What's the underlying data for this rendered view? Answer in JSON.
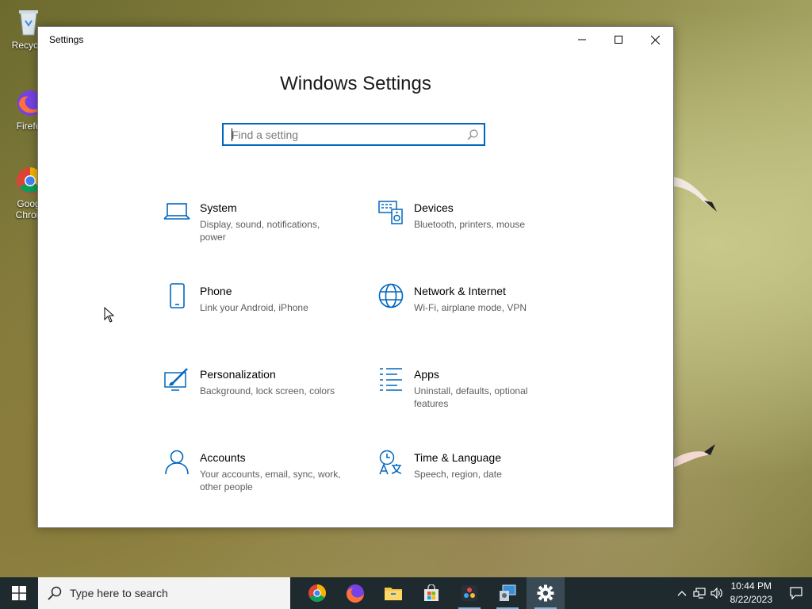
{
  "desktop": {
    "icons": [
      {
        "label": "Recycle"
      },
      {
        "label": "Firefo"
      },
      {
        "label": "Goog",
        "label2": "Chron"
      }
    ]
  },
  "window": {
    "title": "Settings",
    "heading": "Windows Settings",
    "search_placeholder": "Find a setting",
    "tiles": [
      {
        "name": "System",
        "desc": "Display, sound, notifications, power",
        "icon": "laptop-icon"
      },
      {
        "name": "Devices",
        "desc": "Bluetooth, printers, mouse",
        "icon": "keyboard-speaker-icon"
      },
      {
        "name": "Phone",
        "desc": "Link your Android, iPhone",
        "icon": "phone-icon"
      },
      {
        "name": "Network & Internet",
        "desc": "Wi-Fi, airplane mode, VPN",
        "icon": "globe-icon"
      },
      {
        "name": "Personalization",
        "desc": "Background, lock screen, colors",
        "icon": "paint-brush-icon"
      },
      {
        "name": "Apps",
        "desc": "Uninstall, defaults, optional features",
        "icon": "apps-list-icon"
      },
      {
        "name": "Accounts",
        "desc": "Your accounts, email, sync, work, other people",
        "icon": "person-icon"
      },
      {
        "name": "Time & Language",
        "desc": "Speech, region, date",
        "icon": "clock-language-icon"
      }
    ]
  },
  "taskbar": {
    "search_text": "Type here to search",
    "time": "10:44 PM",
    "date": "8/22/2023",
    "apps": [
      "chrome-icon",
      "firefox-icon",
      "file-explorer-icon",
      "store-icon",
      "davinci-icon",
      "control-panel-icon",
      "settings-gear-icon"
    ]
  },
  "colors": {
    "accent": "#0067c0",
    "taskbar": "#1f2a2e"
  }
}
